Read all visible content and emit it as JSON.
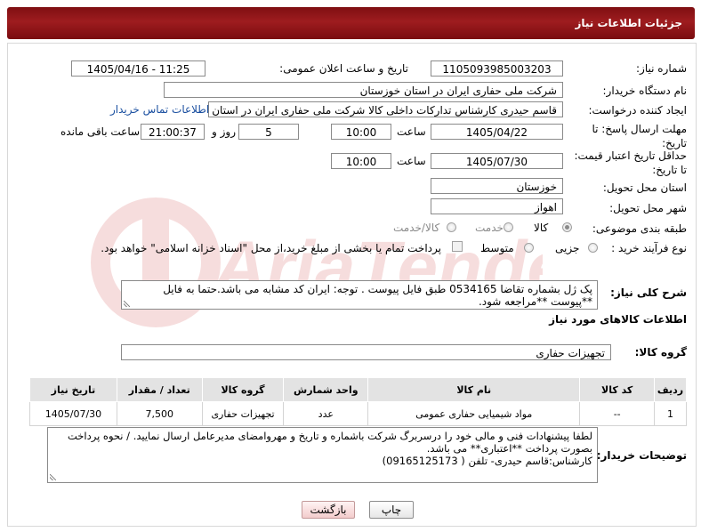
{
  "header": {
    "title": "جزئیات اطلاعات نیاز"
  },
  "fields": {
    "need_number": {
      "label": "شماره نیاز:",
      "value": "1105093985003203"
    },
    "announce_datetime": {
      "label": "تاریخ و ساعت اعلان عمومی:",
      "value": "1405/04/16 - 11:25"
    },
    "buyer_org": {
      "label": "نام دستگاه خریدار:",
      "value": "شرکت ملی حفاری ایران در استان خوزستان"
    },
    "requester": {
      "label": "ایجاد کننده درخواست:",
      "value": "قاسم حیدری کارشناس تدارکات داخلی کالا شرکت ملی حفاری ایران در استان خ",
      "contact_link": "اطلاعات تماس خریدار"
    },
    "reply_deadline": {
      "label_line1": "مهلت ارسال پاسخ: تا",
      "label_line2": "تاریخ:",
      "date": "1405/04/22",
      "time_label": "ساعت",
      "time": "10:00",
      "days": "5",
      "days_label": "روز و",
      "remaining": "21:00:37",
      "remaining_label": "ساعت باقی مانده"
    },
    "price_validity": {
      "label_line1": "حداقل تاریخ اعتبار قیمت:",
      "label_line2": "تا تاریخ:",
      "date": "1405/07/30",
      "time_label": "ساعت",
      "time": "10:00"
    },
    "delivery_province": {
      "label": "استان محل تحویل:",
      "value": "خوزستان"
    },
    "delivery_city": {
      "label": "شهر محل تحویل:",
      "value": "اهواز"
    },
    "category": {
      "label": "طبقه بندی موضوعی:",
      "options": [
        "کالا",
        "خدمت",
        "کالا/خدمت"
      ],
      "selected": "کالا"
    },
    "process": {
      "label": "نوع فرآیند خرید :",
      "options": [
        "جزیی",
        "متوسط"
      ],
      "selected": "",
      "payment_note": "پرداخت تمام یا بخشی از مبلغ خرید،از محل \"اسناد خزانه اسلامی\" خواهد بود."
    }
  },
  "general_desc": {
    "label": "شرح کلی نیاز:",
    "text": "پک ژل بشماره تقاضا 0534165 طبق فایل پیوست . توجه: ایران کد مشابه می باشد.حتما به فایل **پیوست **مراجعه شود."
  },
  "goods_section": {
    "title": "اطلاعات کالاهای مورد نیاز"
  },
  "goods_group": {
    "label": "گروه کالا:",
    "value": "تجهیزات حفاری"
  },
  "table": {
    "headers": [
      "ردیف",
      "کد کالا",
      "نام کالا",
      "واحد شمارش",
      "گروه کالا",
      "تعداد / مقدار",
      "تاریخ نیاز"
    ],
    "rows": [
      [
        "1",
        "--",
        "مواد شیمیایی حفاری عمومی",
        "عدد",
        "تجهیزات حفاری",
        "7,500",
        "1405/07/30"
      ]
    ]
  },
  "buyer_notes": {
    "label": "توضیحات خریدار:",
    "line1": "لطفا پیشنهادات فنی و مالی خود را درسربرگ شرکت باشماره و تاریخ و مهروامضای مدیرعامل ارسال نمایید. / نحوه پرداخت",
    "line2": "بصورت پرداخت **اعتباری** می باشد.",
    "line3": "کارشناس:قاسم حیدری- تلفن ( 09165125173)"
  },
  "buttons": {
    "print": "چاپ",
    "back": "بازگشت"
  },
  "watermark": "AriaTender.net"
}
